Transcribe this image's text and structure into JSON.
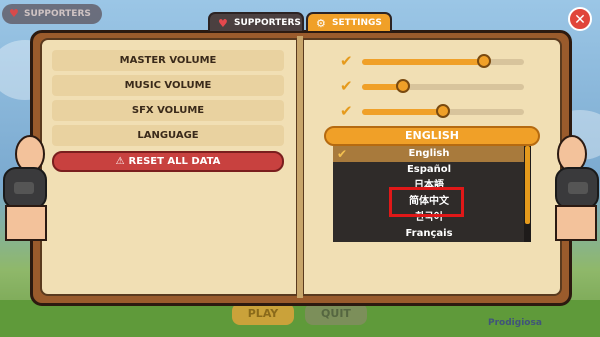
{
  "background": {
    "supporters_pill": "SUPPORTERS",
    "play_label": "PLAY",
    "quit_label": "QUIT",
    "brand_label": "Prodigiosa"
  },
  "tabs": {
    "supporters": "SUPPORTERS",
    "settings": "SETTINGS"
  },
  "close_button": {
    "icon": "close-icon",
    "glyph": "✕"
  },
  "settings": {
    "master_volume": "MASTER VOLUME",
    "music_volume": "MUSIC VOLUME",
    "sfx_volume": "SFX VOLUME",
    "language": "LANGUAGE",
    "reset_all_data": "RESET ALL DATA"
  },
  "sliders": {
    "master_volume_level": 0.75,
    "music_volume_level": 0.25,
    "sfx_volume_level": 0.5
  },
  "language": {
    "current": "ENGLISH",
    "options": [
      "English",
      "Español",
      "日本語",
      "简体中文",
      "한국어",
      "Français"
    ],
    "selected_index": 0,
    "scroll_position": 0
  },
  "colors": {
    "accent_orange": "#f0a028",
    "reset_red": "#c8413f",
    "page_parchment": "#f1dfb4",
    "book_brown": "#9a5b2c",
    "annotation_red": "#e01818"
  }
}
